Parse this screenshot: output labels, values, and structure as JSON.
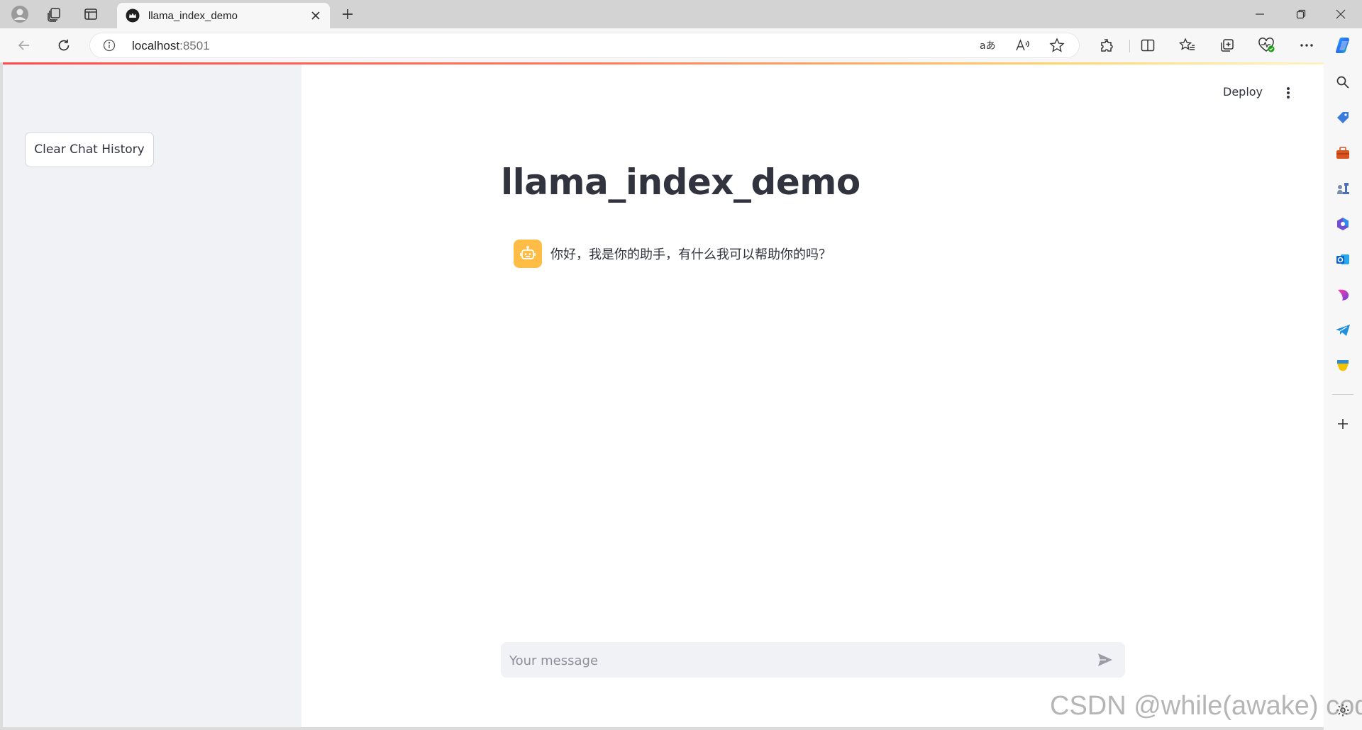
{
  "browser": {
    "tab": {
      "title": "llama_index_demo"
    },
    "address": {
      "host": "localhost",
      "port": ":8501"
    }
  },
  "sidebar": {
    "clear_button_label": "Clear Chat History"
  },
  "header": {
    "deploy_label": "Deploy"
  },
  "main": {
    "title": "llama_index_demo",
    "messages": [
      {
        "role": "assistant",
        "text": "你好，我是你的助手，有什么我可以帮助你的吗？"
      }
    ],
    "chat_input": {
      "placeholder": "Your message",
      "value": ""
    }
  },
  "colors": {
    "accent": "#ff4b4b",
    "bot_avatar": "#ffbd45",
    "sidebar_bg": "#f0f2f6",
    "text": "#31333f"
  },
  "icons": {
    "tabstrip": [
      "profile-icon",
      "collections-icon",
      "tab-actions-icon"
    ],
    "toolbar": [
      "back-icon",
      "refresh-icon",
      "info-icon",
      "translate-icon",
      "read-aloud-icon",
      "favorite-star-icon",
      "extensions-icon",
      "split-screen-icon",
      "favorites-icon",
      "collections-icon",
      "browser-essentials-icon",
      "more-icon",
      "copilot-icon"
    ],
    "edgebar": [
      "search-icon",
      "shopping-tag-icon",
      "tools-icon",
      "games-icon",
      "microsoft365-icon",
      "outlook-icon",
      "designer-icon",
      "telegram-icon",
      "drop-icon",
      "add-icon",
      "settings-icon"
    ]
  },
  "watermark": "CSDN @while(awake) code"
}
